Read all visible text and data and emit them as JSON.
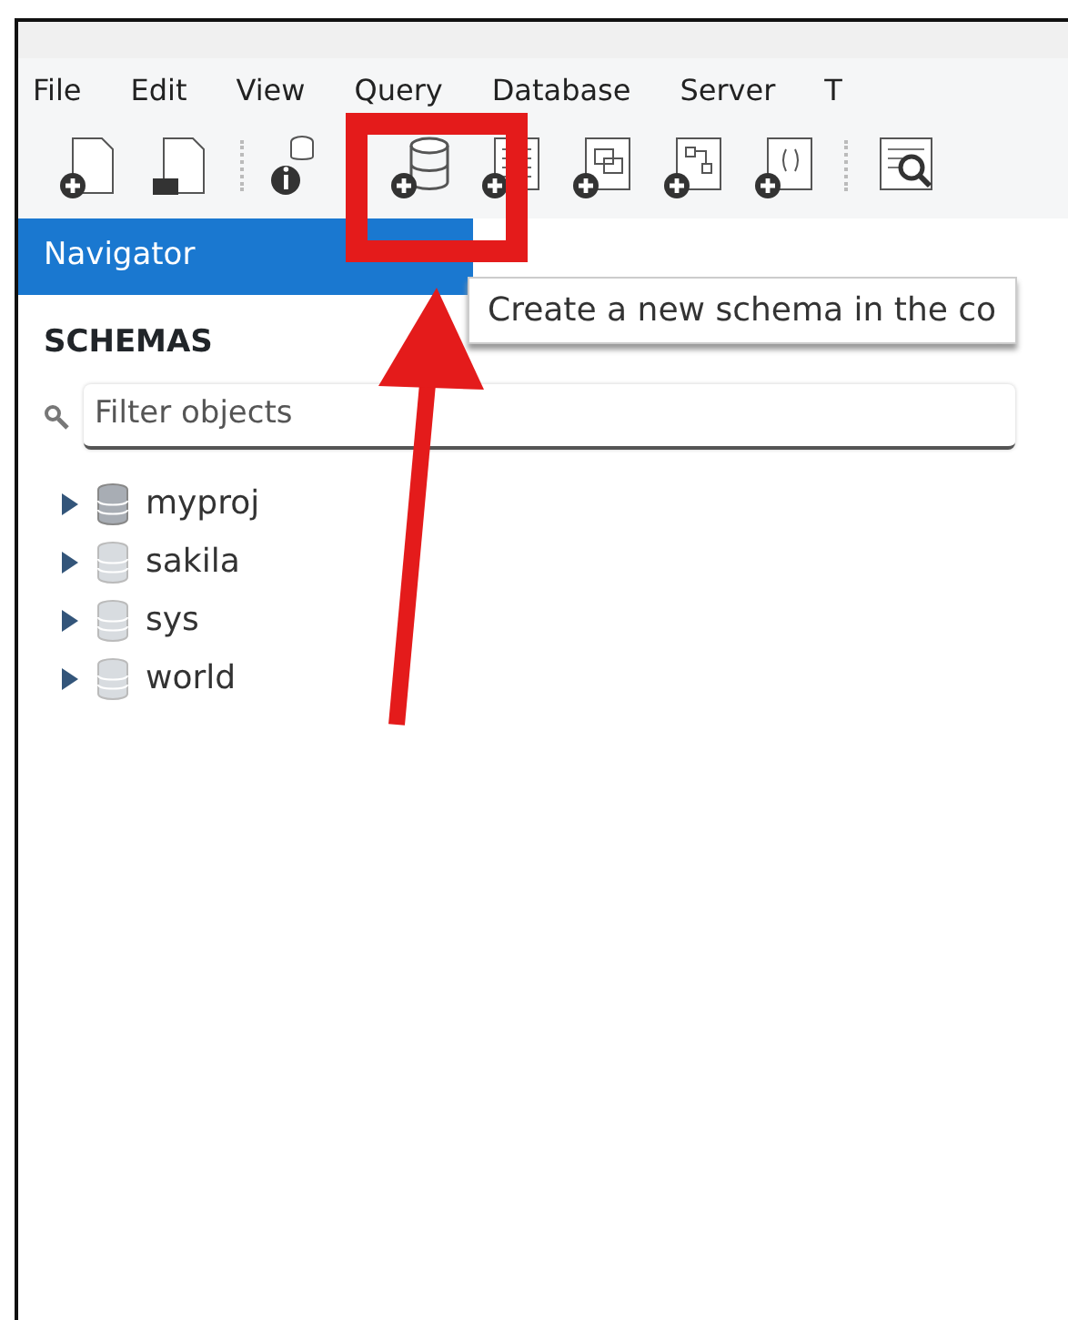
{
  "menu": [
    "File",
    "Edit",
    "View",
    "Query",
    "Database",
    "Server",
    "T"
  ],
  "navigator": {
    "title": "Navigator"
  },
  "tooltip": "Create a new schema in the co",
  "schemas": {
    "heading": "SCHEMAS",
    "filter": {
      "placeholder": "Filter objects"
    },
    "items": [
      {
        "name": "myproj",
        "default": true,
        "expanded": false
      },
      {
        "name": "sakila",
        "default": false,
        "expanded": false
      },
      {
        "name": "sys",
        "default": false,
        "expanded": false
      },
      {
        "name": "world",
        "default": false,
        "expanded": false
      }
    ]
  }
}
